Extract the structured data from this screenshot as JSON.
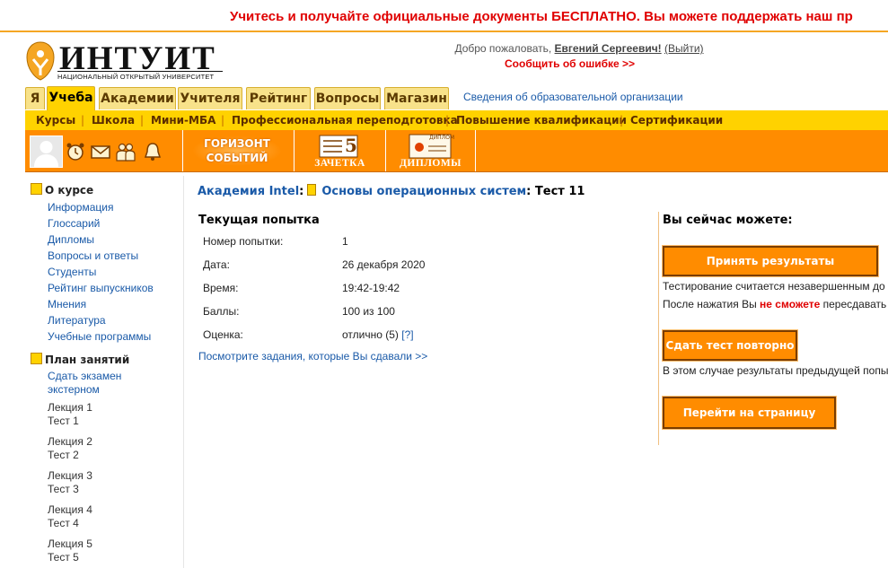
{
  "banner": {
    "text": "Учитесь и получайте официальные документы БЕСПЛАТНО. Вы можете поддержать наш пр"
  },
  "logo": {
    "name": "ИНТУИТ",
    "subtitle": "НАЦИОНАЛЬНЫЙ ОТКРЫТЫЙ УНИВЕРСИТЕТ"
  },
  "header": {
    "welcome_prefix": "Добро пожаловать, ",
    "user_name": "Евгений Сергеевич!",
    "exit_label": "(Выйти)",
    "report_error": "Сообщить об ошибке >>"
  },
  "tabs": [
    {
      "label": "Я"
    },
    {
      "label": "Учеба"
    },
    {
      "label": "Академии"
    },
    {
      "label": "Учителя"
    },
    {
      "label": "Рейтинг"
    },
    {
      "label": "Вопросы"
    },
    {
      "label": "Магазин"
    }
  ],
  "org_info_link": "Сведения об образовательной организации",
  "subnav": [
    {
      "label": "Курсы"
    },
    {
      "label": "Школа"
    },
    {
      "label": "Мини-МБА"
    },
    {
      "label": "Профессиональная переподготовка"
    },
    {
      "label": "Повышение квалификации"
    },
    {
      "label": "Сертификации"
    }
  ],
  "toolbar": {
    "horizon_line1": "ГОРИЗОНТ",
    "horizon_line2": "СОБЫТИЙ",
    "zachetka_num": "5",
    "zachetka": "ЗАЧЕТКА",
    "diploma_tag": "ДИПЛОМ",
    "diplomas": "ДИПЛОМЫ",
    "accent": "#ff8c00"
  },
  "sidebar": {
    "about_title": "О курсе",
    "about_items": [
      {
        "label": "Информация"
      },
      {
        "label": "Глоссарий"
      },
      {
        "label": "Дипломы"
      },
      {
        "label": "Вопросы и ответы"
      },
      {
        "label": "Студенты"
      },
      {
        "label": "Рейтинг выпускников"
      },
      {
        "label": "Мнения"
      },
      {
        "label": "Литература"
      },
      {
        "label": "Учебные программы"
      }
    ],
    "plan_title": "План занятий",
    "plan_exam_line1": "Сдать экзамен",
    "plan_exam_line2": "экстерном",
    "lessons": [
      {
        "lecture": "Лекция 1",
        "test": "Тест 1"
      },
      {
        "lecture": "Лекция 2",
        "test": "Тест 2"
      },
      {
        "lecture": "Лекция 3",
        "test": "Тест 3"
      },
      {
        "lecture": "Лекция 4",
        "test": "Тест 4"
      },
      {
        "lecture": "Лекция 5",
        "test": "Тест 5"
      }
    ]
  },
  "breadcrumb": {
    "academy": "Академия Intel",
    "colon1": ":",
    "course": "Основы операционных систем",
    "current": ": Тест 11"
  },
  "attempt": {
    "title": "Текущая попытка",
    "rows": [
      {
        "label": "Номер попытки:",
        "value": "1"
      },
      {
        "label": "Дата:",
        "value": "26 декабря 2020"
      },
      {
        "label": "Время:",
        "value": "19:42-19:42"
      },
      {
        "label": "Баллы:",
        "value": "100 из 100"
      },
      {
        "label": "Оценка:",
        "value": "отлично (5)"
      }
    ],
    "help_mark": "[?]",
    "see_tasks": "Посмотрите задания, которые Вы сдавали >>"
  },
  "actions": {
    "title": "Вы сейчас можете:",
    "accept_button": "Принять результаты тестирования",
    "accept_note1": "Тестирование считается незавершенным до т",
    "accept_note2_prefix": "После нажатия Вы ",
    "accept_note2_red": "не сможете",
    "accept_note2_suffix": " пересдавать",
    "retake_button": "Сдать тест повторно",
    "retake_note": "В этом случае результаты предыдущей попы",
    "course_button": "Перейти на страницу курса"
  }
}
